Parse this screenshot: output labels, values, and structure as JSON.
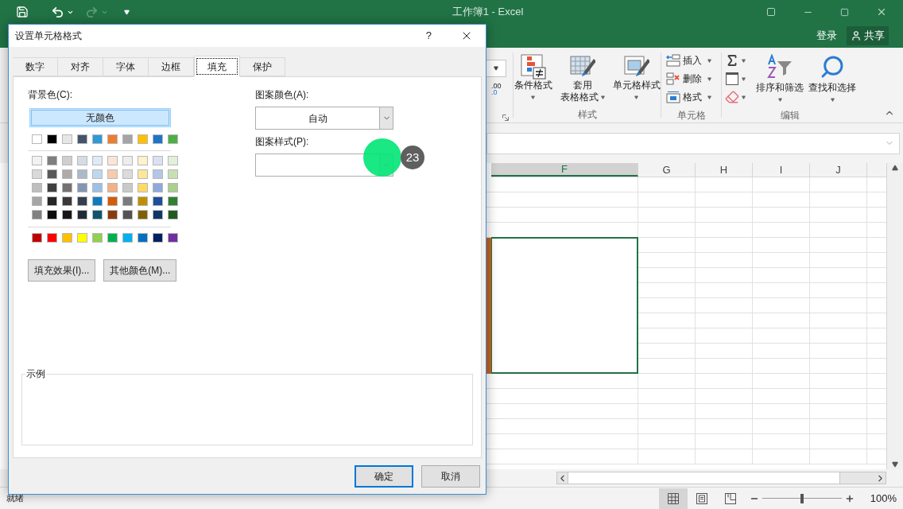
{
  "app_title": "工作簿1 - Excel",
  "account": {
    "sign_in": "登录",
    "share": "共享"
  },
  "ribbon": {
    "decimal_top": ".00",
    "decimal_bottom": ".0",
    "styles_group": {
      "label": "样式",
      "buttons": [
        {
          "kind": "conditional",
          "lines": [
            "条件格式"
          ]
        },
        {
          "kind": "table",
          "lines": [
            "套用",
            "表格格式"
          ]
        },
        {
          "kind": "cellstyle",
          "lines": [
            "单元格样式"
          ]
        }
      ]
    },
    "cells_group": {
      "label": "单元格",
      "buttons": [
        {
          "kind": "insert",
          "label": "插入"
        },
        {
          "kind": "delete",
          "label": "删除"
        },
        {
          "kind": "format",
          "label": "格式"
        }
      ]
    },
    "editing_group": {
      "label": "编辑",
      "small_buttons": [
        {
          "kind": "sum"
        },
        {
          "kind": "fill"
        },
        {
          "kind": "clear"
        }
      ],
      "large_buttons": [
        {
          "kind": "sort",
          "label": "排序和筛选"
        },
        {
          "kind": "find",
          "label": "查找和选择"
        }
      ]
    }
  },
  "columns": [
    {
      "label": "F",
      "selected": true
    },
    {
      "label": "G",
      "selected": false
    },
    {
      "label": "H",
      "selected": false
    },
    {
      "label": "I",
      "selected": false
    },
    {
      "label": "J",
      "selected": false
    }
  ],
  "dialog": {
    "title": "设置单元格格式",
    "help": "?",
    "tabs": [
      {
        "label": "数字",
        "selected": false
      },
      {
        "label": "对齐",
        "selected": false
      },
      {
        "label": "字体",
        "selected": false
      },
      {
        "label": "边框",
        "selected": false
      },
      {
        "label": "填充",
        "selected": true
      },
      {
        "label": "保护",
        "selected": false
      }
    ],
    "background_label": "背景色(C):",
    "no_color": {
      "label": "无颜色",
      "selected": true
    },
    "theme_colors": [
      {
        "color": "#ffffff"
      },
      {
        "color": "#000000"
      },
      {
        "color": "#e7e6e6"
      },
      {
        "color": "#44546a"
      },
      {
        "color": "#2e9ad6"
      },
      {
        "color": "#ed7d31"
      },
      {
        "color": "#a5a5a5"
      },
      {
        "color": "#ffc000"
      },
      {
        "color": "#1f74c8"
      },
      {
        "color": "#4caf46"
      }
    ],
    "tint_rows": [
      [
        {
          "color": "#f2f2f2"
        },
        {
          "color": "#7f7f7f"
        },
        {
          "color": "#d0cece"
        },
        {
          "color": "#d6dce4"
        },
        {
          "color": "#ddebf7"
        },
        {
          "color": "#fce4d6"
        },
        {
          "color": "#ededed"
        },
        {
          "color": "#fff2cc"
        },
        {
          "color": "#d9e1f2"
        },
        {
          "color": "#e2efda"
        }
      ],
      [
        {
          "color": "#d9d9d9"
        },
        {
          "color": "#595959"
        },
        {
          "color": "#aeaaaa"
        },
        {
          "color": "#acb9ca"
        },
        {
          "color": "#bdd7ee"
        },
        {
          "color": "#f8cbad"
        },
        {
          "color": "#dbdbdb"
        },
        {
          "color": "#ffe699"
        },
        {
          "color": "#b4c6e7"
        },
        {
          "color": "#c6e0b4"
        }
      ],
      [
        {
          "color": "#bfbfbf"
        },
        {
          "color": "#404040"
        },
        {
          "color": "#757171"
        },
        {
          "color": "#8497b0"
        },
        {
          "color": "#9bc2e6"
        },
        {
          "color": "#f4b084"
        },
        {
          "color": "#c9c9c9"
        },
        {
          "color": "#ffd966"
        },
        {
          "color": "#8ea9db"
        },
        {
          "color": "#a9d08e"
        }
      ],
      [
        {
          "color": "#a6a6a6"
        },
        {
          "color": "#262626"
        },
        {
          "color": "#3a3838"
        },
        {
          "color": "#333f4f"
        },
        {
          "color": "#0e7bc0"
        },
        {
          "color": "#d65b07"
        },
        {
          "color": "#7b7b7b"
        },
        {
          "color": "#bf8f00"
        },
        {
          "color": "#1f4e9a"
        },
        {
          "color": "#2f8033"
        }
      ],
      [
        {
          "color": "#808080"
        },
        {
          "color": "#0d0d0d"
        },
        {
          "color": "#161616"
        },
        {
          "color": "#222b35"
        },
        {
          "color": "#0b5570"
        },
        {
          "color": "#8a3a0c"
        },
        {
          "color": "#525252"
        },
        {
          "color": "#806000"
        },
        {
          "color": "#103668"
        },
        {
          "color": "#215a21"
        }
      ]
    ],
    "standard_colors": [
      {
        "color": "#c00000"
      },
      {
        "color": "#ff0000"
      },
      {
        "color": "#ffc000"
      },
      {
        "color": "#ffff00"
      },
      {
        "color": "#92d050"
      },
      {
        "color": "#00b050"
      },
      {
        "color": "#00b0f0"
      },
      {
        "color": "#0070c0"
      },
      {
        "color": "#002060"
      },
      {
        "color": "#7030a0"
      }
    ],
    "fill_effects": "填充效果(I)...",
    "more_colors": "其他颜色(M)...",
    "pattern_color_label": "图案颜色(A):",
    "pattern_color_value": "自动",
    "pattern_style_label": "图案样式(P):",
    "sample_label": "示例",
    "ok": "确定",
    "cancel": "取消"
  },
  "step_marker": "23",
  "status_bar": {
    "status": "就绪",
    "views": [
      {
        "kind": "normal",
        "selected": true
      },
      {
        "kind": "page_layout",
        "selected": false
      },
      {
        "kind": "page_break",
        "selected": false
      }
    ],
    "zoom": {
      "level": 0.5,
      "reading": "100%"
    }
  }
}
